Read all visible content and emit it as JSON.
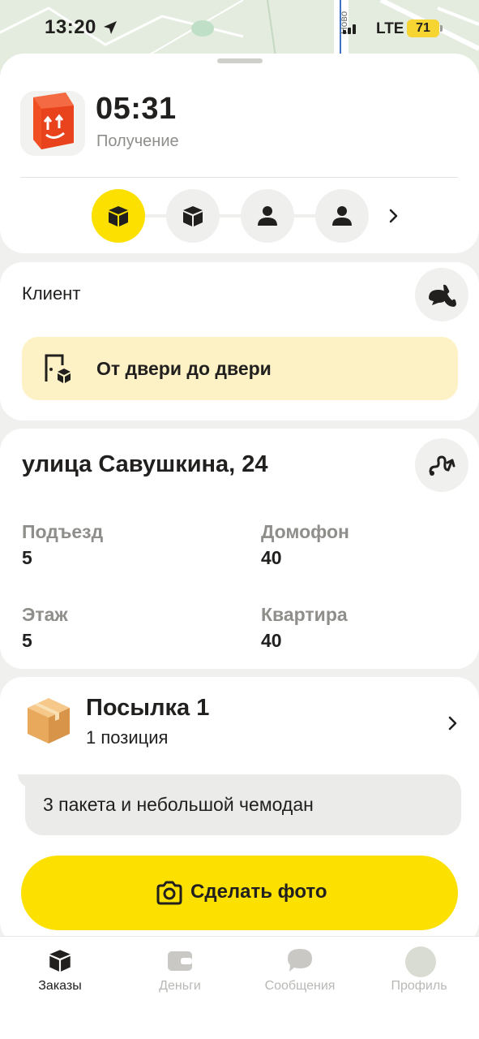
{
  "status_bar": {
    "time": "13:20",
    "network": "LTE",
    "battery": "71"
  },
  "map": {
    "street_label": "Ново"
  },
  "order": {
    "eta": "05:31",
    "stage": "Получение",
    "steps": [
      {
        "icon": "box-icon",
        "active": true
      },
      {
        "icon": "box-icon",
        "active": false
      },
      {
        "icon": "person-icon",
        "active": false
      },
      {
        "icon": "person-icon",
        "active": false
      }
    ]
  },
  "client": {
    "label": "Клиент",
    "delivery_type": "От двери до двери"
  },
  "address": {
    "street": "улица Савушкина, 24",
    "fields": [
      {
        "label": "Подъезд",
        "value": "5"
      },
      {
        "label": "Домофон",
        "value": "40"
      },
      {
        "label": "Этаж",
        "value": "5"
      },
      {
        "label": "Квартира",
        "value": "40"
      }
    ]
  },
  "parcel": {
    "title": "Посылка 1",
    "subtitle": "1 позиция",
    "comment": "3 пакета и небольшой чемодан",
    "photo_button": "Сделать фото"
  },
  "tabs": [
    {
      "label": "Заказы",
      "icon": "orders-icon",
      "active": true
    },
    {
      "label": "Деньги",
      "icon": "wallet-icon",
      "active": false
    },
    {
      "label": "Сообщения",
      "icon": "chat-icon",
      "active": false
    },
    {
      "label": "Профиль",
      "icon": "avatar",
      "active": false
    }
  ],
  "colors": {
    "accent": "#fce000",
    "pill": "#fdf2c6",
    "brand_icon": "#f04e23"
  }
}
